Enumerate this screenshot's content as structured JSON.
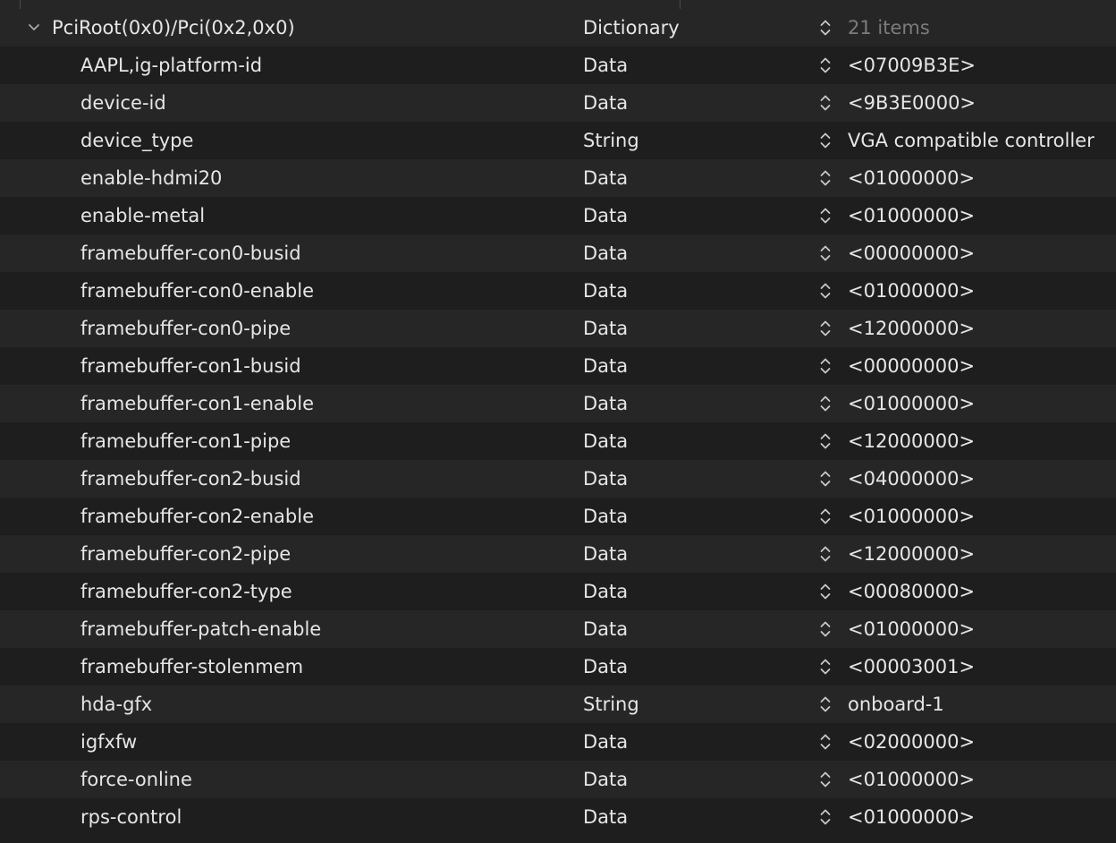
{
  "root": {
    "key": "PciRoot(0x0)/Pci(0x2,0x0)",
    "type": "Dictionary",
    "value": "21 items",
    "disclosure_icon": "chevron-down-icon",
    "stepper_icon": "up-down-chevron-icon"
  },
  "entries": [
    {
      "key": "AAPL,ig-platform-id",
      "type": "Data",
      "value": "<07009B3E>"
    },
    {
      "key": "device-id",
      "type": "Data",
      "value": "<9B3E0000>"
    },
    {
      "key": "device_type",
      "type": "String",
      "value": "VGA compatible controller"
    },
    {
      "key": "enable-hdmi20",
      "type": "Data",
      "value": "<01000000>"
    },
    {
      "key": "enable-metal",
      "type": "Data",
      "value": "<01000000>"
    },
    {
      "key": "framebuffer-con0-busid",
      "type": "Data",
      "value": "<00000000>"
    },
    {
      "key": "framebuffer-con0-enable",
      "type": "Data",
      "value": "<01000000>"
    },
    {
      "key": "framebuffer-con0-pipe",
      "type": "Data",
      "value": "<12000000>"
    },
    {
      "key": "framebuffer-con1-busid",
      "type": "Data",
      "value": "<00000000>"
    },
    {
      "key": "framebuffer-con1-enable",
      "type": "Data",
      "value": "<01000000>"
    },
    {
      "key": "framebuffer-con1-pipe",
      "type": "Data",
      "value": "<12000000>"
    },
    {
      "key": "framebuffer-con2-busid",
      "type": "Data",
      "value": "<04000000>"
    },
    {
      "key": "framebuffer-con2-enable",
      "type": "Data",
      "value": "<01000000>"
    },
    {
      "key": "framebuffer-con2-pipe",
      "type": "Data",
      "value": "<12000000>"
    },
    {
      "key": "framebuffer-con2-type",
      "type": "Data",
      "value": "<00080000>"
    },
    {
      "key": "framebuffer-patch-enable",
      "type": "Data",
      "value": "<01000000>"
    },
    {
      "key": "framebuffer-stolenmem",
      "type": "Data",
      "value": "<00003001>"
    },
    {
      "key": "hda-gfx",
      "type": "String",
      "value": "onboard-1"
    },
    {
      "key": "igfxfw",
      "type": "Data",
      "value": "<02000000>"
    },
    {
      "key": "force-online",
      "type": "Data",
      "value": "<01000000>"
    },
    {
      "key": "rps-control",
      "type": "Data",
      "value": "<01000000>"
    }
  ],
  "colors": {
    "background": "#1e1e1e",
    "row_alt": "#262626",
    "text": "#e6e6e6",
    "muted_text": "#7c7c7c"
  }
}
